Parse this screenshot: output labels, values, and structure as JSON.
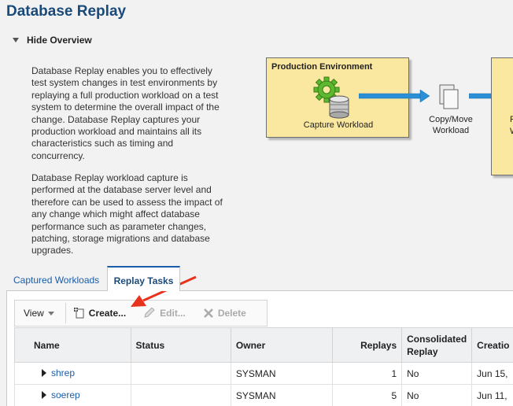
{
  "page": {
    "title": "Database Replay"
  },
  "overview": {
    "toggle_label": "Hide Overview",
    "paragraph1": "Database Replay enables you to effectively test system changes in test environments by replaying a full production workload on a test system to determine the overall impact of the change. Database Replay captures your production workload and maintains all its characteristics such as timing and concurrency.",
    "paragraph2": "Database Replay workload capture is performed at the database server level and therefore can be used to assess the impact of any change which might affect database performance such as parameter changes, patching, storage migrations and database upgrades."
  },
  "diagram": {
    "production_title": "Production Environment",
    "capture_label": "Capture Workload",
    "copy_label_line1": "Copy/Move",
    "copy_label_line2": "Workload",
    "test_fragment1": "P",
    "test_fragment2": "W",
    "box_color": "#fbe8a0",
    "arrow_color": "#2a8fd6"
  },
  "tabs": [
    {
      "label": "Captured Workloads",
      "active": false
    },
    {
      "label": "Replay Tasks",
      "active": true
    }
  ],
  "toolbar": {
    "view_label": "View",
    "create_label": "Create...",
    "edit_label": "Edit...",
    "delete_label": "Delete"
  },
  "table": {
    "columns": {
      "name": "Name",
      "status": "Status",
      "owner": "Owner",
      "replays": "Replays",
      "consolidated": "Consolidated Replay",
      "creation": "Creatio"
    },
    "rows": [
      {
        "name": "shrep",
        "status": "",
        "owner": "SYSMAN",
        "replays": "1",
        "consolidated": "No",
        "creation": "Jun 15,"
      },
      {
        "name": "soerep",
        "status": "",
        "owner": "SYSMAN",
        "replays": "5",
        "consolidated": "No",
        "creation": "Jun 11,"
      }
    ]
  },
  "annotation": {
    "arrow_color": "#e8321e"
  }
}
